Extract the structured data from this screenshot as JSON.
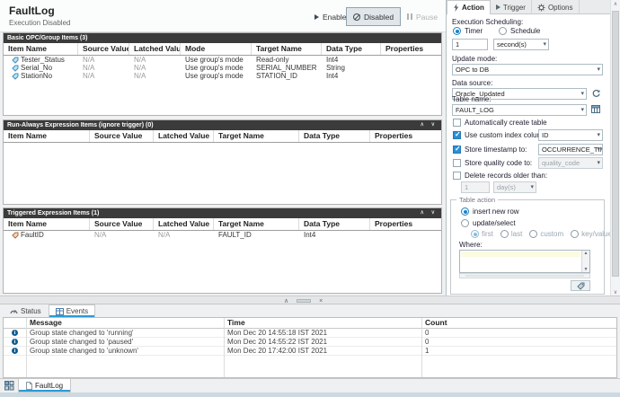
{
  "header": {
    "title": "FaultLog",
    "subtitle": "Execution Disabled",
    "buttons": {
      "enabled": "Enabled",
      "disabled": "Disabled",
      "pause": "Pause"
    }
  },
  "tables": {
    "basic": {
      "title": "Basic OPC/Group Items (3)",
      "columns": [
        "Item Name",
        "Source Value",
        "Latched Value",
        "Mode",
        "Target Name",
        "Data Type",
        "Properties"
      ],
      "rows": [
        {
          "item": "Tester_Status",
          "source": "N/A",
          "latched": "N/A",
          "mode": "Use group's mode",
          "target": "Read-only",
          "dtype": "Int4",
          "props": ""
        },
        {
          "item": "Serial_No",
          "source": "N/A",
          "latched": "N/A",
          "mode": "Use group's mode",
          "target": "SERIAL_NUMBER",
          "dtype": "String",
          "props": ""
        },
        {
          "item": "StationNo",
          "source": "N/A",
          "latched": "N/A",
          "mode": "Use group's mode",
          "target": "STATION_ID",
          "dtype": "Int4",
          "props": ""
        }
      ]
    },
    "runAlways": {
      "title": "Run-Always Expression Items (ignore trigger) (0)",
      "columns": [
        "Item Name",
        "Source Value",
        "Latched Value",
        "Target Name",
        "Data Type",
        "Properties"
      ]
    },
    "triggered": {
      "title": "Triggered Expression Items (1)",
      "columns": [
        "Item Name",
        "Source Value",
        "Latched Value",
        "Target Name",
        "Data Type",
        "Properties"
      ],
      "rows": [
        {
          "item": "FaultID",
          "source": "N/A",
          "latched": "N/A",
          "target": "FAULT_ID",
          "dtype": "Int4",
          "props": ""
        }
      ]
    }
  },
  "panel": {
    "tabs": {
      "action": "Action",
      "trigger": "Trigger",
      "options": "Options"
    },
    "execution_scheduling_label": "Execution Scheduling:",
    "timer_label": "Timer",
    "schedule_label": "Schedule",
    "timer_value": "1",
    "timer_unit": "second(s)",
    "update_mode_label": "Update mode:",
    "update_mode_value": "OPC to DB",
    "data_source_label": "Data source:",
    "data_source_value": "Oracle_Updated",
    "table_name_label": "Table name:",
    "table_name_value": "FAULT_LOG",
    "auto_create_label": "Automatically create table",
    "custom_index_label": "Use custom index column:",
    "custom_index_value": "ID",
    "store_timestamp_label": "Store timestamp to:",
    "store_timestamp_value": "OCCURRENCE_TIME",
    "store_quality_label": "Store quality code to:",
    "store_quality_value": "quality_code",
    "delete_records_label": "Delete records older than:",
    "delete_value": "1",
    "delete_unit": "day(s)",
    "table_action_label": "Table action",
    "insert_new_row_label": "insert new row",
    "update_select_label": "update/select",
    "sub_first": "first",
    "sub_last": "last",
    "sub_custom": "custom",
    "sub_kv": "key/value pairs",
    "where_label": "Where:"
  },
  "bottom": {
    "status_tab": "Status",
    "events_tab": "Events",
    "columns": [
      "Message",
      "Time",
      "Count"
    ],
    "rows": [
      {
        "message": "Group state changed to 'running'",
        "time": "Mon Dec 20 14:55:18 IST 2021",
        "count": "0"
      },
      {
        "message": "Group state changed to 'paused'",
        "time": "Mon Dec 20 14:55:22 IST 2021",
        "count": "0"
      },
      {
        "message": "Group state changed to 'unknown'",
        "time": "Mon Dec 20 17:42:00 IST 2021",
        "count": "1"
      }
    ]
  },
  "taskbar": {
    "tab_label": "FaultLog"
  }
}
